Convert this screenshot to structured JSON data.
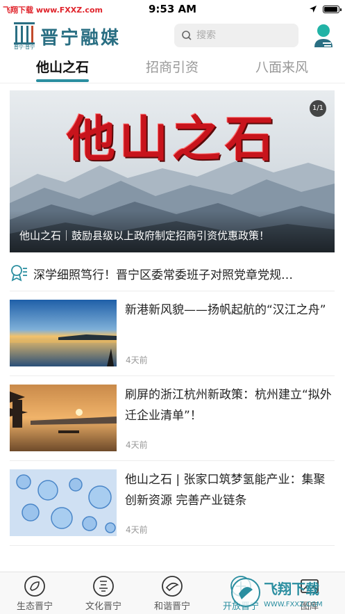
{
  "status_bar": {
    "watermark": "飞翔下载 www.FXXZ.com",
    "time": "9:53 AM",
    "battery_level": 0.95
  },
  "header": {
    "brand": "晋宁融媒",
    "logo_sub": "晋宁·晋宁",
    "search_placeholder": "搜索"
  },
  "tabs": [
    {
      "label": "他山之石",
      "active": true
    },
    {
      "label": "招商引资",
      "active": false
    },
    {
      "label": "八面来风",
      "active": false
    }
  ],
  "banner": {
    "art_title": "他山之石",
    "page_indicator": "1/1",
    "caption": "他山之石｜鼓励县级以上政府制定招商引资优惠政策！"
  },
  "headline": {
    "text": "深学细照笃行！晋宁区委常委班子对照党章党规…"
  },
  "news": [
    {
      "title": "新港新风貌——扬帆起航的“汉江之舟”",
      "time": "4天前",
      "thumb": "lake-sunset"
    },
    {
      "title": "刷屏的浙江杭州新政策：杭州建立“拟外迁企业清单”！",
      "time": "4天前",
      "thumb": "pavilion-sunset"
    },
    {
      "title": "他山之石 | 张家口筑梦氢能产业：集聚创新资源 完善产业链条",
      "time": "4天前",
      "thumb": "water-bubbles"
    }
  ],
  "bottom_nav": [
    {
      "label": "生态晋宁",
      "icon": "leaf-circle-icon",
      "active": false
    },
    {
      "label": "文化晋宁",
      "icon": "culture-circle-icon",
      "active": false
    },
    {
      "label": "和谐晋宁",
      "icon": "harmony-circle-icon",
      "active": false
    },
    {
      "label": "开放晋宁",
      "icon": "open-circle-icon",
      "active": true
    },
    {
      "label": "图库",
      "icon": "gallery-icon",
      "active": false
    }
  ],
  "watermark_bottom": {
    "line1": "飞翔下载",
    "line2": "WWW.FXXZ.COM"
  },
  "colors": {
    "accent": "#2a8ea0",
    "brand": "#2a6f83",
    "art_red": "#c8141c"
  }
}
